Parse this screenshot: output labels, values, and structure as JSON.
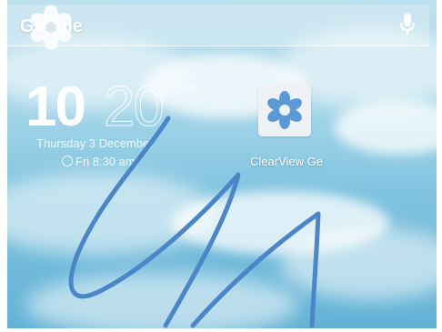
{
  "search_bar": {
    "label": "Google"
  },
  "clock": {
    "hours": "10",
    "minutes": "20",
    "ampm": "am",
    "date": "Thursday 3 December",
    "alarm": "Fri 8:30 am"
  },
  "apps": [
    {
      "label": "ClearView Ge"
    }
  ],
  "colors": {
    "sky_top": "#bfe0ee",
    "sky_bottom": "#62b2d6",
    "scribble": "#4a86c8",
    "flower": "#5a98d6"
  }
}
